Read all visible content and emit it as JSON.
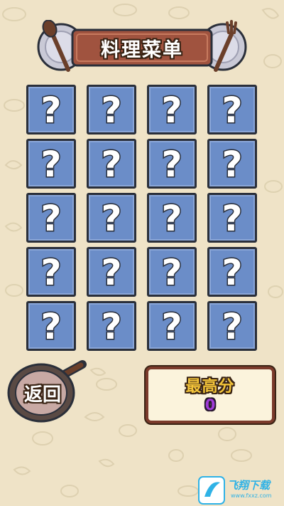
{
  "header": {
    "title": "料理菜单"
  },
  "cards": [
    {
      "label": "?"
    },
    {
      "label": "?"
    },
    {
      "label": "?"
    },
    {
      "label": "?"
    },
    {
      "label": "?"
    },
    {
      "label": "?"
    },
    {
      "label": "?"
    },
    {
      "label": "?"
    },
    {
      "label": "?"
    },
    {
      "label": "?"
    },
    {
      "label": "?"
    },
    {
      "label": "?"
    },
    {
      "label": "?"
    },
    {
      "label": "?"
    },
    {
      "label": "?"
    },
    {
      "label": "?"
    },
    {
      "label": "?"
    },
    {
      "label": "?"
    },
    {
      "label": "?"
    },
    {
      "label": "?"
    }
  ],
  "back_button": {
    "label": "返回",
    "icon": "frying-pan-icon"
  },
  "score": {
    "label": "最高分",
    "value": "0"
  },
  "watermark": {
    "name": "飞翔下载",
    "url": "www.fxxz.com"
  },
  "colors": {
    "background": "#efe3c7",
    "card": "#6b8dc8",
    "title_plate": "#a0533f",
    "score_label": "#f3c43a",
    "score_value": "#a13bd8"
  }
}
